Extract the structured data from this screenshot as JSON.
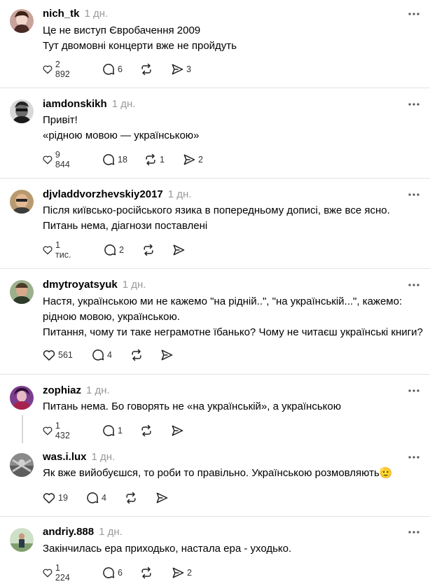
{
  "icons": {
    "like": "heart-icon",
    "comment": "comment-icon",
    "repost": "repost-icon",
    "share": "share-icon",
    "more": "more-icon"
  },
  "posts": [
    {
      "username": "nich_tk",
      "time": "1 дн.",
      "lines": [
        "Це не виступ Євробачення 2009",
        "Тут двомовні концерти вже не пройдуть"
      ],
      "likes": "2 892",
      "comments": "6",
      "reposts": "",
      "shares": "3"
    },
    {
      "username": "iamdonskikh",
      "time": "1 дн.",
      "lines": [
        "Привіт!",
        "«рідною мовою — українською»"
      ],
      "likes": "9 844",
      "comments": "18",
      "reposts": "1",
      "shares": "2"
    },
    {
      "username": "djvladdvorzhevskiy2017",
      "time": "1 дн.",
      "lines": [
        "Після київсько-російського язика в попередньому дописі, вже все ясно.",
        "Питань нема, діагнози поставлені"
      ],
      "likes": "1 тис.",
      "comments": "2",
      "reposts": "",
      "shares": ""
    },
    {
      "username": "dmytroyatsyuk",
      "time": "1 дн.",
      "lines": [
        "Настя, українською ми не кажемо \"на рідній..\", \"на українській...\", кажемо:",
        "рідною мовою, українською.",
        "Питання, чому ти таке неграмотне їбанько? Чому не читаєш українські книги?"
      ],
      "likes": "561",
      "comments": "4",
      "reposts": "",
      "shares": ""
    },
    {
      "username": "zophiaz",
      "time": "1 дн.",
      "lines": [
        "Питань нема. Бо говорять не «на українській», а українською"
      ],
      "likes": "1 432",
      "comments": "1",
      "reposts": "",
      "shares": ""
    },
    {
      "username": "was.i.lux",
      "time": "1 дн.",
      "lines": [
        "Як вже вийобуєшся, то роби то правільно. Українською розмовляють🫡"
      ],
      "likes": "19",
      "comments": "4",
      "reposts": "",
      "shares": ""
    },
    {
      "username": "andriy.888",
      "time": "1 дн.",
      "lines": [
        "Закінчилась ера приходько, настала ера - уходько."
      ],
      "likes": "1 224",
      "comments": "6",
      "reposts": "",
      "shares": "2"
    }
  ]
}
